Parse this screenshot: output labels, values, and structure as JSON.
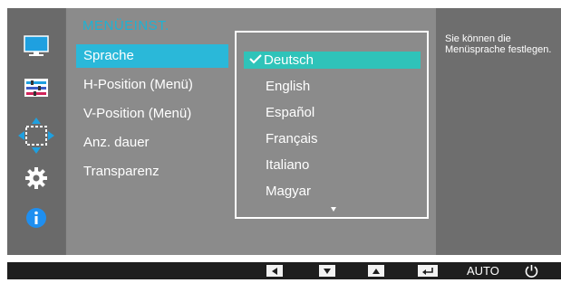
{
  "menu": {
    "title": "MENÜEINST.",
    "items": [
      {
        "label": "Sprache",
        "selected": true
      },
      {
        "label": "H-Position (Menü)"
      },
      {
        "label": "V-Position (Menü)"
      },
      {
        "label": "Anz. dauer"
      },
      {
        "label": "Transparenz"
      }
    ]
  },
  "dropdown": {
    "selected": "Deutsch",
    "options": [
      "Deutsch",
      "English",
      "Español",
      "Français",
      "Italiano",
      "Magyar"
    ]
  },
  "help": {
    "text": "Sie können die Menüsprache festlegen."
  },
  "bottombar": {
    "auto_label": "AUTO"
  },
  "sidebar_icons": [
    "picture-icon",
    "color-icon",
    "size-position-icon",
    "setup-icon",
    "information-icon"
  ],
  "colors": {
    "accent_blue": "#2ab8d9",
    "accent_teal": "#2fc3b9",
    "title_blue": "#1fb2d3",
    "panel_gray": "#8b8b8b",
    "dark_gray": "#6e6e6e"
  }
}
